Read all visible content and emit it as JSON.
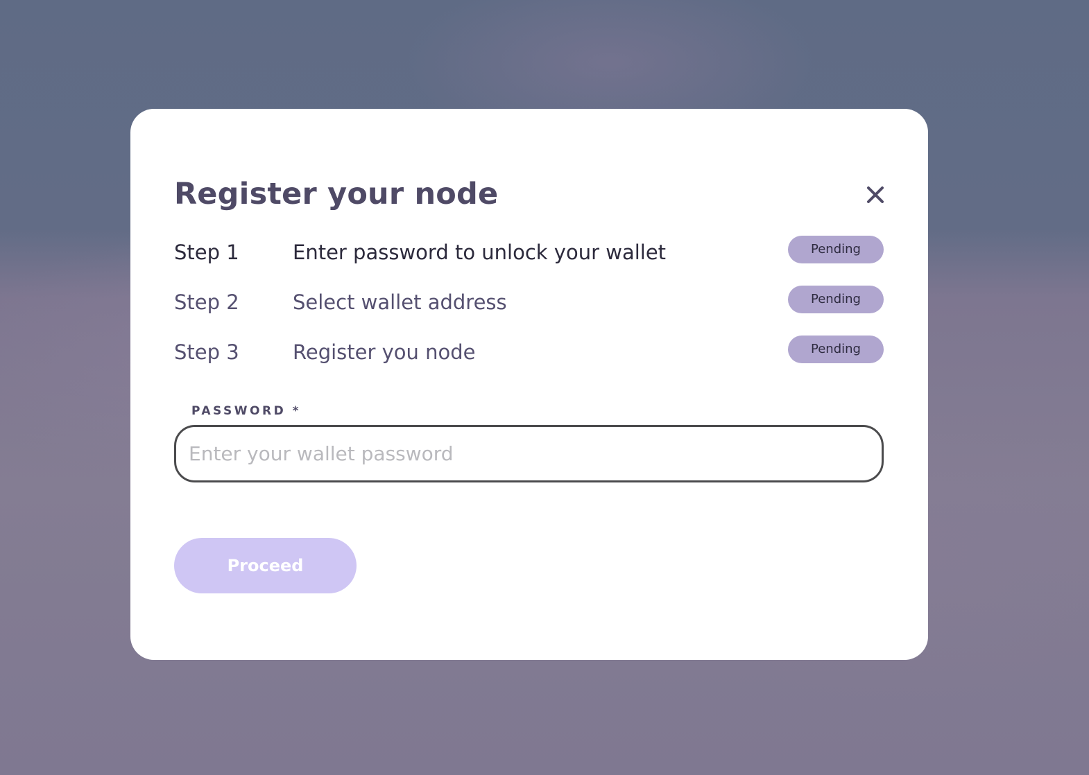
{
  "modal": {
    "title": "Register your node",
    "close_icon": "close-icon"
  },
  "steps": [
    {
      "number": "Step 1",
      "description": "Enter password to unlock your wallet",
      "status": "Pending"
    },
    {
      "number": "Step 2",
      "description": "Select wallet address",
      "status": "Pending"
    },
    {
      "number": "Step 3",
      "description": "Register you node",
      "status": "Pending"
    }
  ],
  "password_field": {
    "label": "PASSWORD *",
    "value": "",
    "placeholder": "Enter your wallet password"
  },
  "actions": {
    "proceed_label": "Proceed"
  },
  "colors": {
    "title": "#4f4a66",
    "badge_bg": "#b0a6cf",
    "proceed_bg": "#cfc6f4",
    "input_border": "#4b4b4d"
  }
}
